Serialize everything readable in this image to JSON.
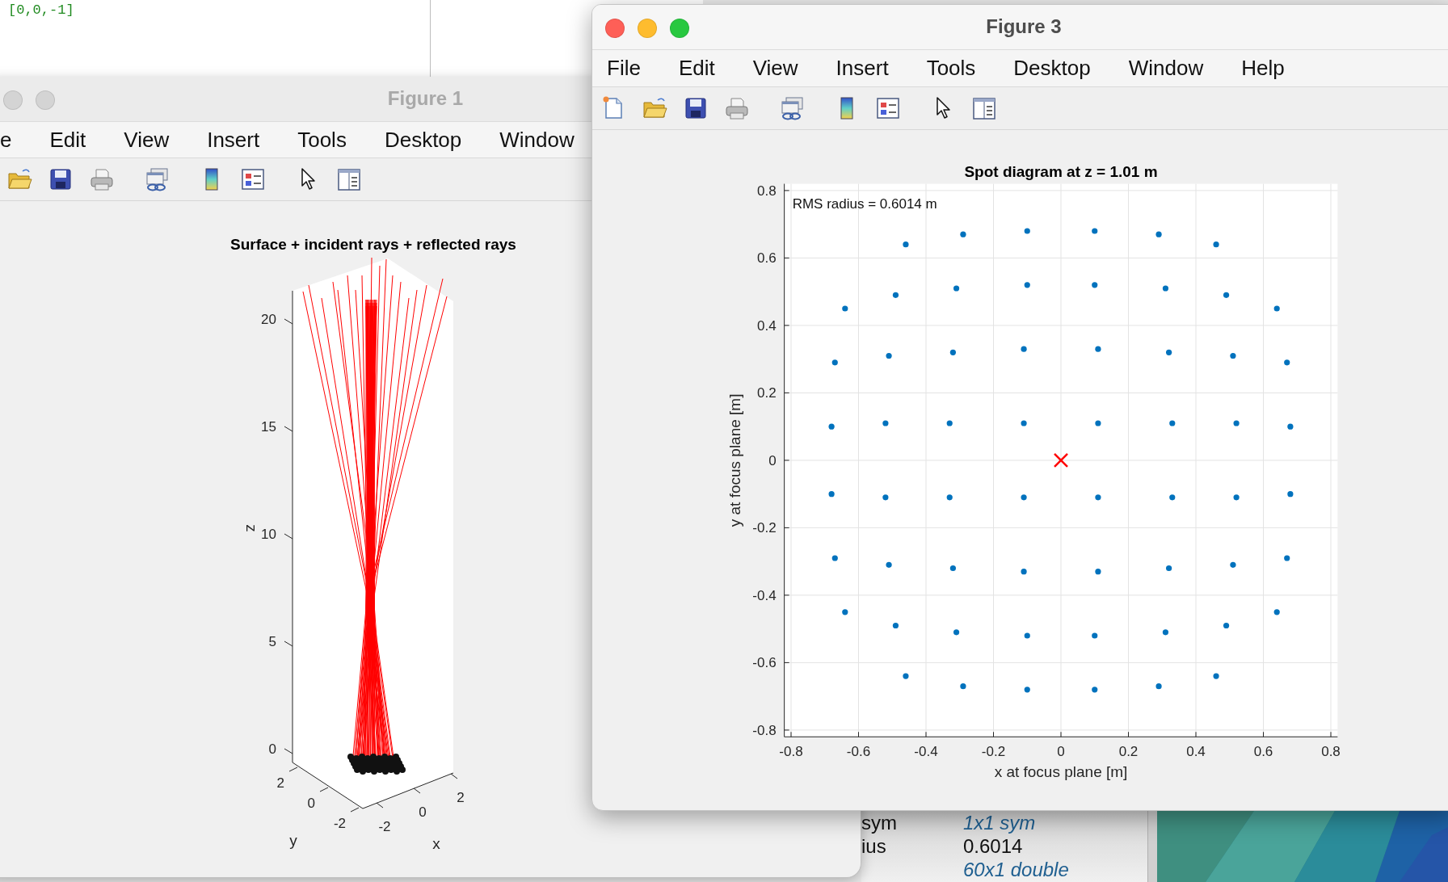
{
  "editor": {
    "code_line": "[0,0,-1]"
  },
  "workspace": {
    "rows": [
      {
        "name": "sym",
        "value": "1x1 sym",
        "kind": "class"
      },
      {
        "name": "ius",
        "value": "0.6014",
        "kind": "number"
      },
      {
        "value": "60x1 double",
        "kind": "class"
      }
    ]
  },
  "figure_1": {
    "title": "Figure 1",
    "active": false,
    "menu": [
      "e",
      "Edit",
      "View",
      "Insert",
      "Tools",
      "Desktop",
      "Window"
    ],
    "plot": {
      "title": "Surface + incident rays + reflected rays",
      "xlabel": "x",
      "ylabel": "y",
      "zlabel": "z",
      "xticks": [
        "-2",
        "0",
        "2"
      ],
      "yticks": [
        "2",
        "0",
        "-2"
      ],
      "zticks": [
        "20",
        "15",
        "10",
        "5",
        "0"
      ]
    }
  },
  "figure_3": {
    "title": "Figure 3",
    "active": true,
    "menu": [
      "File",
      "Edit",
      "View",
      "Insert",
      "Tools",
      "Desktop",
      "Window",
      "Help"
    ],
    "chart_data": {
      "type": "scatter",
      "title": "Spot diagram at z = 1.01 m",
      "xlabel": "x at focus plane [m]",
      "ylabel": "y at focus plane [m]",
      "grid": true,
      "xlim": [
        -0.82,
        0.82
      ],
      "ylim": [
        -0.82,
        0.82
      ],
      "xticks": [
        -0.8,
        -0.6,
        -0.4,
        -0.2,
        0,
        0.2,
        0.4,
        0.6,
        0.8
      ],
      "yticks": [
        -0.8,
        -0.6,
        -0.4,
        -0.2,
        0,
        0.2,
        0.4,
        0.6,
        0.8
      ],
      "series": [
        {
          "color": "#0072bd",
          "x": [
            -0.46,
            -0.29,
            -0.1,
            0.1,
            0.29,
            0.46,
            -0.64,
            -0.49,
            -0.31,
            -0.1,
            0.1,
            0.31,
            0.49,
            0.64,
            -0.67,
            -0.51,
            -0.32,
            -0.11,
            0.11,
            0.32,
            0.51,
            0.67,
            -0.68,
            -0.52,
            -0.33,
            -0.11,
            0.11,
            0.33,
            0.52,
            0.68,
            -0.46,
            -0.29,
            -0.1,
            0.1,
            0.29,
            0.46,
            -0.64,
            -0.49,
            -0.31,
            -0.1,
            0.1,
            0.31,
            0.49,
            0.64,
            -0.67,
            -0.51,
            -0.32,
            -0.11,
            0.11,
            0.32,
            0.51,
            0.67,
            -0.68,
            -0.52,
            -0.33,
            -0.11,
            0.11,
            0.33,
            0.52,
            0.68
          ],
          "values": [
            0.64,
            0.67,
            0.68,
            0.68,
            0.67,
            0.64,
            0.45,
            0.49,
            0.51,
            0.52,
            0.52,
            0.51,
            0.49,
            0.45,
            0.29,
            0.31,
            0.32,
            0.33,
            0.33,
            0.32,
            0.31,
            0.29,
            0.1,
            0.11,
            0.11,
            0.11,
            0.11,
            0.11,
            0.11,
            0.1,
            -0.64,
            -0.67,
            -0.68,
            -0.68,
            -0.67,
            -0.64,
            -0.45,
            -0.49,
            -0.51,
            -0.52,
            -0.52,
            -0.51,
            -0.49,
            -0.45,
            -0.29,
            -0.31,
            -0.32,
            -0.33,
            -0.33,
            -0.32,
            -0.31,
            -0.29,
            -0.1,
            -0.11,
            -0.11,
            -0.11,
            -0.11,
            -0.11,
            -0.11,
            -0.1
          ]
        },
        {
          "color": "#ff0000",
          "x": [
            0
          ],
          "values": [
            0
          ]
        }
      ],
      "annotations": [
        "RMS radius = 0.6014 m"
      ]
    }
  }
}
